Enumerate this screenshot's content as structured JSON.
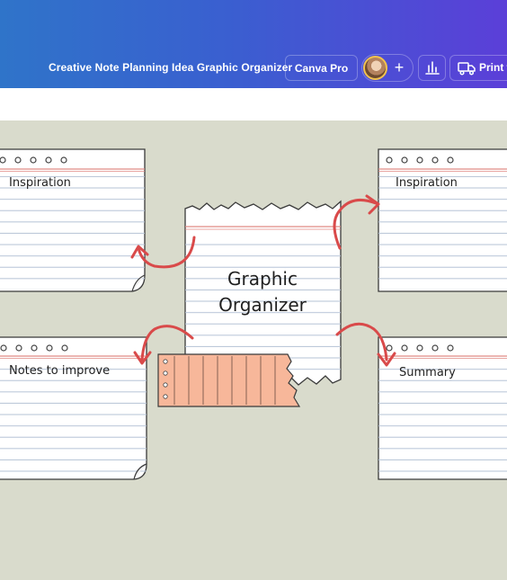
{
  "header": {
    "document_title": "Creative Note Planning Idea Graphic Organizer",
    "canva_pro_label": "Canva Pro",
    "add_label": "+",
    "print_label": "Print w"
  },
  "colors": {
    "header_start": "#2f74c9",
    "header_end": "#5b3fd8",
    "canvas_bg": "#d9dbcc",
    "arrow_red": "#d94a4a",
    "red_rule": "#e08a84",
    "blue_rule": "#b5c3d6",
    "sticky_orange": "#f7b79a"
  },
  "icons": {
    "avatar": "user-avatar",
    "add": "plus-icon",
    "insights": "bar-chart-icon",
    "print": "truck-icon"
  },
  "canvas": {
    "center_title_line1": "Graphic",
    "center_title_line2": "Organizer",
    "notes": {
      "top_left": "Inspiration",
      "top_right": "Inspiration",
      "bottom_left": "Notes to improve",
      "bottom_right": "Summary"
    }
  }
}
